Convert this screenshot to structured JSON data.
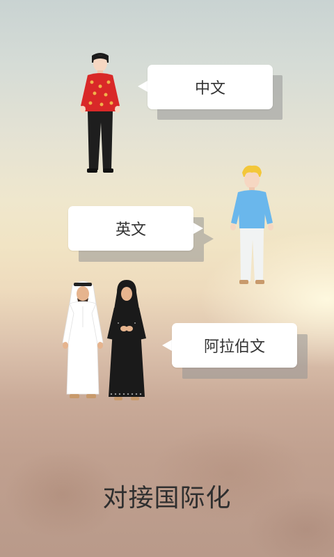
{
  "bubbles": {
    "chinese": "中文",
    "english": "英文",
    "arabic": "阿拉伯文"
  },
  "caption": "对接国际化",
  "colors": {
    "bubble": "#ffffff",
    "bubble_shadow": "#969696",
    "text": "#333333",
    "caption": "#2f2f2f"
  },
  "figures": [
    {
      "name": "man-red-tang-suit"
    },
    {
      "name": "man-blue-sweater-blond"
    },
    {
      "name": "man-white-thobe"
    },
    {
      "name": "woman-black-abaya"
    }
  ]
}
